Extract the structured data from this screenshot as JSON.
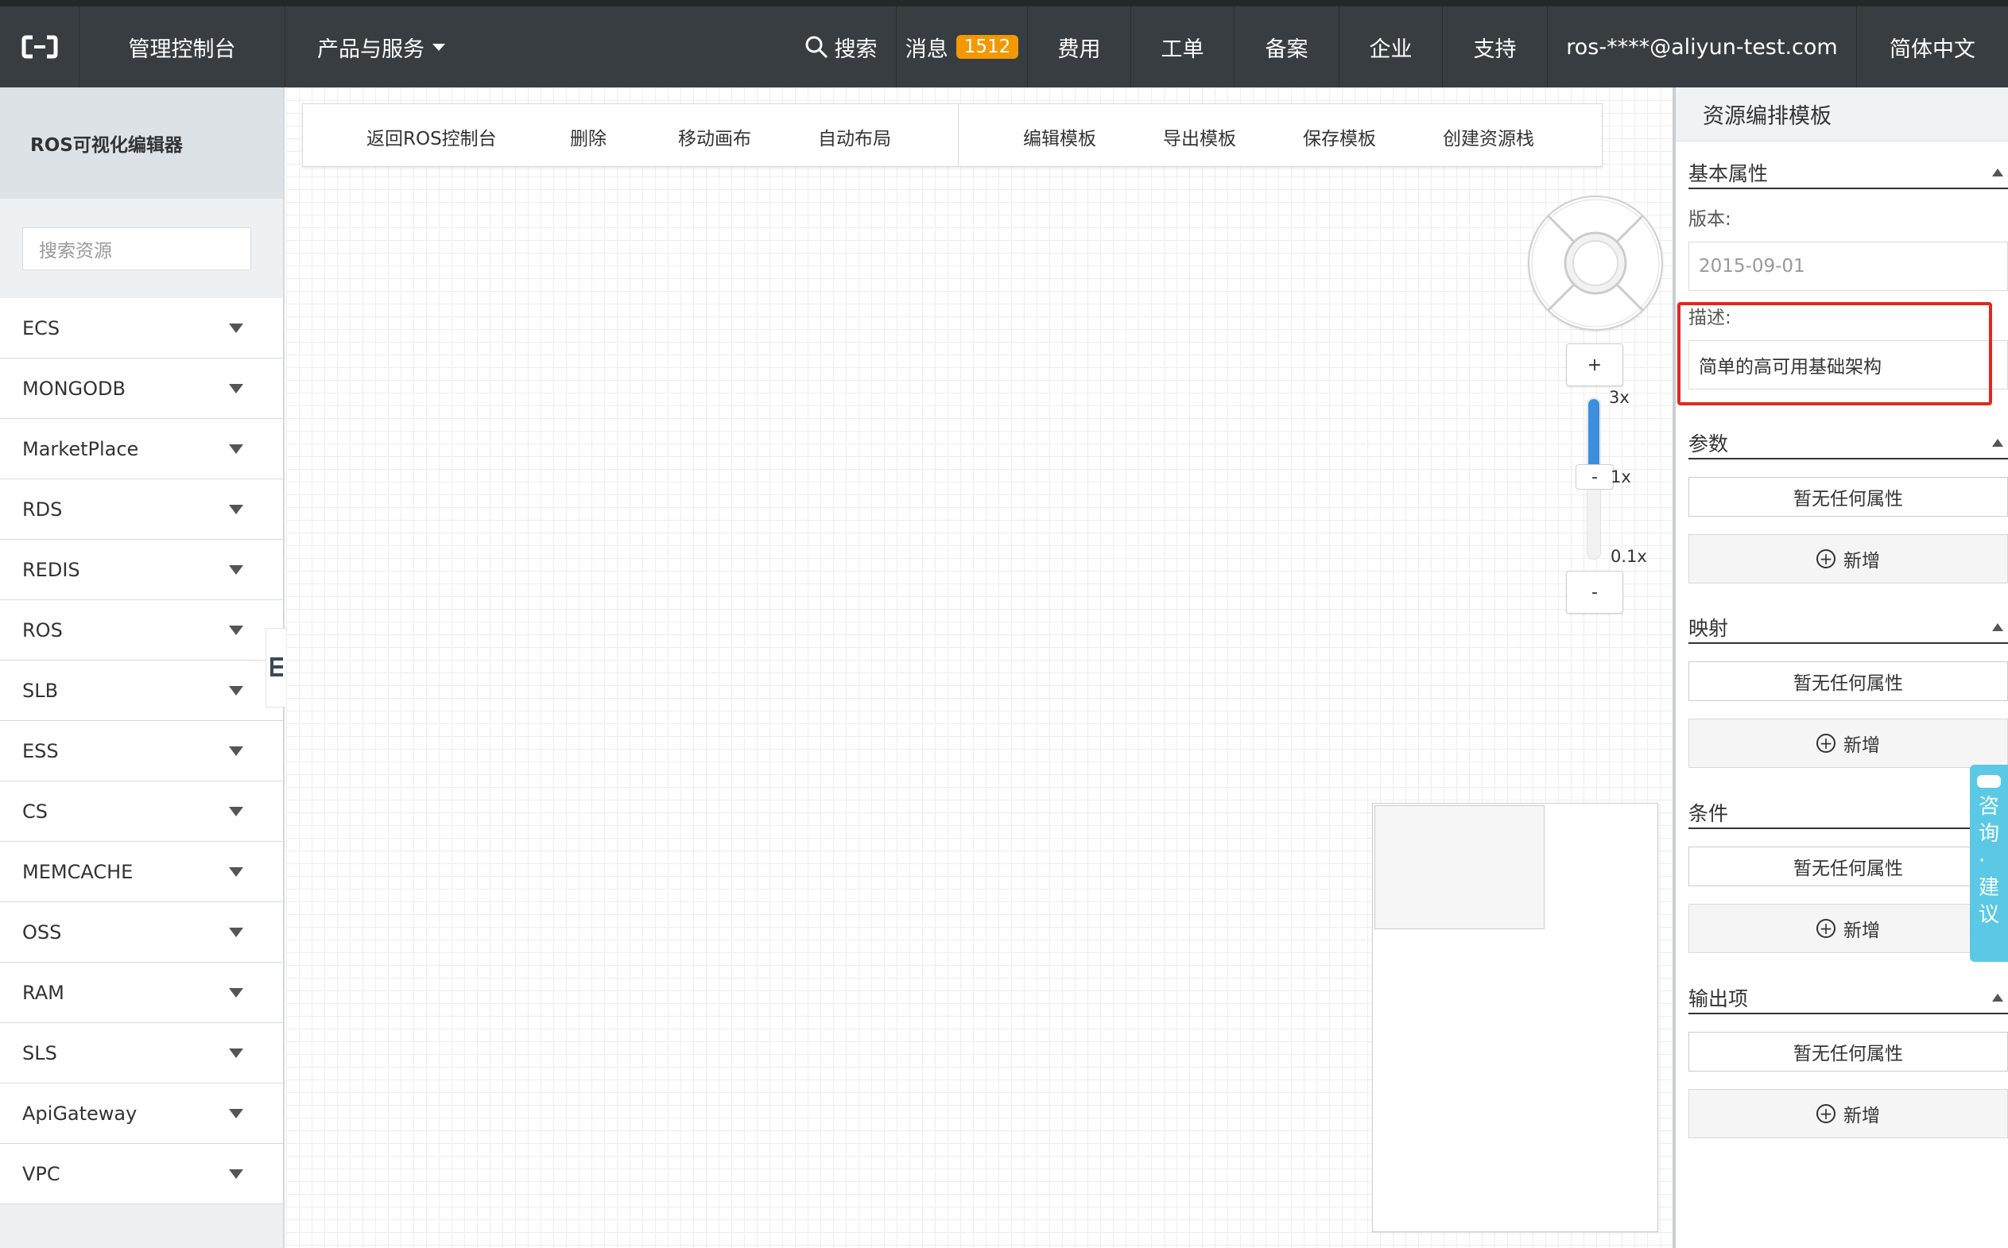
{
  "topnav": {
    "logo_icon": "aliyun-logo-icon",
    "console": "管理控制台",
    "products": "产品与服务",
    "search": "搜索",
    "messages": "消息",
    "messages_count": "1512",
    "fees": "费用",
    "tickets": "工单",
    "beian": "备案",
    "enterprise": "企业",
    "support": "支持",
    "user": "ros-****@aliyun-test.com",
    "language": "简体中文"
  },
  "sidebar": {
    "title": "ROS可视化编辑器",
    "search_placeholder": "搜索资源",
    "categories": [
      "ECS",
      "MONGODB",
      "MarketPlace",
      "RDS",
      "REDIS",
      "ROS",
      "SLB",
      "ESS",
      "CS",
      "MEMCACHE",
      "OSS",
      "RAM",
      "SLS",
      "ApiGateway",
      "VPC"
    ]
  },
  "toolbar": {
    "back": "返回ROS控制台",
    "delete": "删除",
    "move_canvas": "移动画布",
    "auto_layout": "自动布局",
    "edit_template": "编辑模板",
    "export_template": "导出模板",
    "save_template": "保存模板",
    "create_stack": "创建资源栈"
  },
  "zoom": {
    "plus": "+",
    "minus": "-",
    "handle": "-",
    "max_label": "3x",
    "mid_label": "1x",
    "min_label": "0.1x"
  },
  "panel": {
    "title": "资源编排模板",
    "basic": {
      "title": "基本属性",
      "version_label": "版本:",
      "version_value": "2015-09-01",
      "description_label": "描述:",
      "description_value": "简单的高可用基础架构"
    },
    "sections": [
      {
        "title": "参数",
        "empty": "暂无任何属性",
        "add": "新增"
      },
      {
        "title": "映射",
        "empty": "暂无任何属性",
        "add": "新增"
      },
      {
        "title": "条件",
        "empty": "暂无任何属性",
        "add": "新增"
      },
      {
        "title": "输出项",
        "empty": "暂无任何属性",
        "add": "新增"
      }
    ]
  },
  "consult": {
    "chars": [
      "咨",
      "询",
      "·",
      "建",
      "议"
    ]
  },
  "colors": {
    "topnav_bg": "#373d41",
    "badge": "#f39800",
    "highlight": "#e0281e",
    "consult": "#5bc8e6",
    "zoom_fill": "#3d8fdd"
  }
}
